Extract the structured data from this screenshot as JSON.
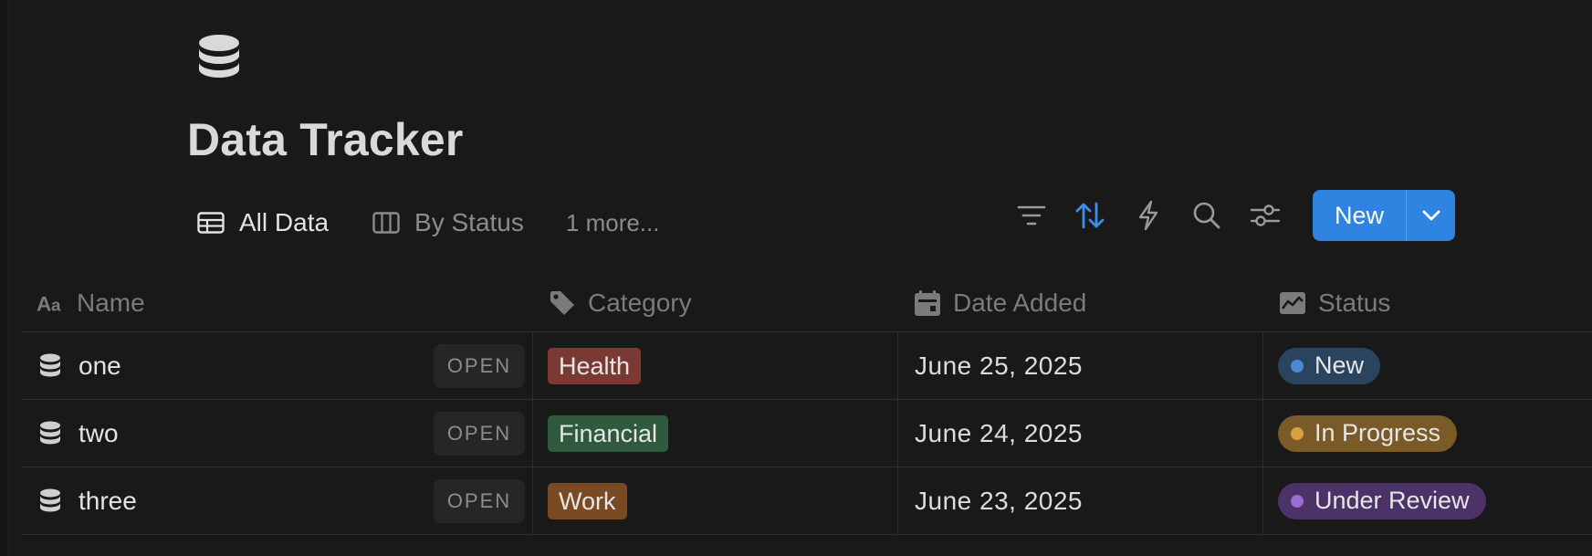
{
  "page": {
    "icon": "database-icon",
    "title": "Data Tracker"
  },
  "views": {
    "tabs": [
      {
        "label": "All Data",
        "icon": "table-icon",
        "active": true
      },
      {
        "label": "By Status",
        "icon": "board-icon",
        "active": false
      }
    ],
    "more_label": "1 more..."
  },
  "toolbar": {
    "icons": [
      "filter-icon",
      "sort-icon",
      "automation-icon",
      "search-icon",
      "settings-icon"
    ],
    "accent": "#2f83e1",
    "new_label": "New"
  },
  "table": {
    "columns": [
      {
        "label": "Name",
        "icon": "text-icon"
      },
      {
        "label": "Category",
        "icon": "tag-icon"
      },
      {
        "label": "Date Added",
        "icon": "calendar-icon"
      },
      {
        "label": "Status",
        "icon": "status-icon"
      }
    ],
    "open_label": "OPEN",
    "rows": [
      {
        "name": "one",
        "category": {
          "label": "Health",
          "color": "#7a3a33"
        },
        "date": "June 25, 2025",
        "status": {
          "label": "New",
          "bg": "#2a4460",
          "dot": "#4a8bd0"
        }
      },
      {
        "name": "two",
        "category": {
          "label": "Financial",
          "color": "#2f5a3e"
        },
        "date": "June 24, 2025",
        "status": {
          "label": "In Progress",
          "bg": "#7a5a26",
          "dot": "#d9a13d"
        }
      },
      {
        "name": "three",
        "category": {
          "label": "Work",
          "color": "#7a4a22"
        },
        "date": "June 23, 2025",
        "status": {
          "label": "Under Review",
          "bg": "#4b3267",
          "dot": "#9a6cd4"
        }
      }
    ]
  }
}
